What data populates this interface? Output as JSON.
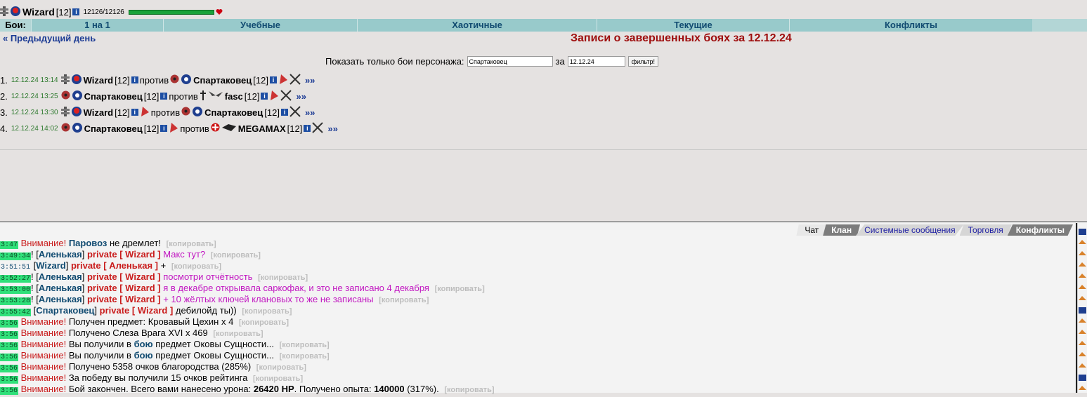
{
  "header": {
    "nick": "Wizard",
    "level": "[12]",
    "hp": "12126/12126"
  },
  "tabs": {
    "label": "Бои:",
    "items": [
      "1 на 1",
      "Учебные",
      "Хаотичные",
      "Текущие",
      "Конфликты"
    ]
  },
  "nav": {
    "prev": "« Предыдущий день",
    "title": "Записи о завершенных боях за 12.12.24"
  },
  "filter": {
    "label": "Показать только бои персонажа:",
    "name_value": "Спартаковец",
    "for_label": "за",
    "date_value": "12.12.24",
    "button": "фильтр!"
  },
  "battles": [
    {
      "num": "1.",
      "ts": "12.12.24 13:14",
      "a": "Wizard",
      "alvl": "[12]",
      "vs": "против",
      "b": "Спартаковец",
      "blvl": "[12]",
      "more": "»»"
    },
    {
      "num": "2.",
      "ts": "12.12.24 13:25",
      "a": "Спартаковец",
      "alvl": "[12]",
      "vs": "против",
      "b": "fasc",
      "blvl": "[12]",
      "more": "»»"
    },
    {
      "num": "3.",
      "ts": "12.12.24 13:30",
      "a": "Wizard",
      "alvl": "[12]",
      "vs": "против",
      "b": "Спартаковец",
      "blvl": "[12]",
      "more": "»»"
    },
    {
      "num": "4.",
      "ts": "12.12.24 14:02",
      "a": "Спартаковец",
      "alvl": "[12]",
      "vs": "против",
      "b": "MEGAMAX",
      "blvl": "[12]",
      "more": "»»"
    }
  ],
  "chat_tabs": [
    "Чат",
    "Клан",
    "Системные сообщения",
    "Торговля",
    "Конфликты"
  ],
  "chat": {
    "copy": "[копировать]",
    "warn": "Внимание!",
    "private": "private",
    "m1": {
      "t": "3:47",
      "who": "Паровоз",
      "text": "не дремлет!"
    },
    "m2": {
      "t": "3:49:34",
      "from": "Аленькая",
      "to": "Wizard",
      "text": "Макс тут?"
    },
    "m3": {
      "t": "3:51:51",
      "from": "Wizard",
      "to": "Аленькая",
      "text": "+"
    },
    "m4": {
      "t": "3:52:27",
      "from": "Аленькая",
      "to": "Wizard",
      "text": "посмотри отчётность"
    },
    "m5": {
      "t": "3:53:00",
      "from": "Аленькая",
      "to": "Wizard",
      "text": "я в декабре открывала саркофак, и это не записано 4 декабря"
    },
    "m6": {
      "t": "3:53:28",
      "from": "Аленькая",
      "to": "Wizard",
      "text": "+ 10 жёлтых ключей клановых то же не записаны"
    },
    "m7": {
      "t": "3:55:42",
      "from": "Спартаковец",
      "to": "Wizard",
      "text": "дебилойд ты))"
    },
    "m8": {
      "t": "3:56",
      "text": "Получен предмет: Кровавый Цехин x 4"
    },
    "m9": {
      "t": "3:56",
      "text": "Получено Слеза Врага XVI x 469"
    },
    "m10": {
      "t": "3:56",
      "pre": "Вы получили в",
      "kw": "бою",
      "post": "предмет Оковы Сущности..."
    },
    "m11": {
      "t": "3:56",
      "pre": "Вы получили в",
      "kw": "бою",
      "post": "предмет Оковы Сущности..."
    },
    "m12": {
      "t": "3:56",
      "text": "Получено 5358 очков благородства (285%)"
    },
    "m13": {
      "t": "3:56",
      "text": "За победу вы получили 15 очков рейтинга"
    },
    "m14": {
      "t": "3:56",
      "pre": "Бой закончен. Всего вами нанесено урона:",
      "dmg": "26420 HP",
      "mid": ". Получено опыта:",
      "exp": "140000",
      "post": "(317%)."
    }
  }
}
